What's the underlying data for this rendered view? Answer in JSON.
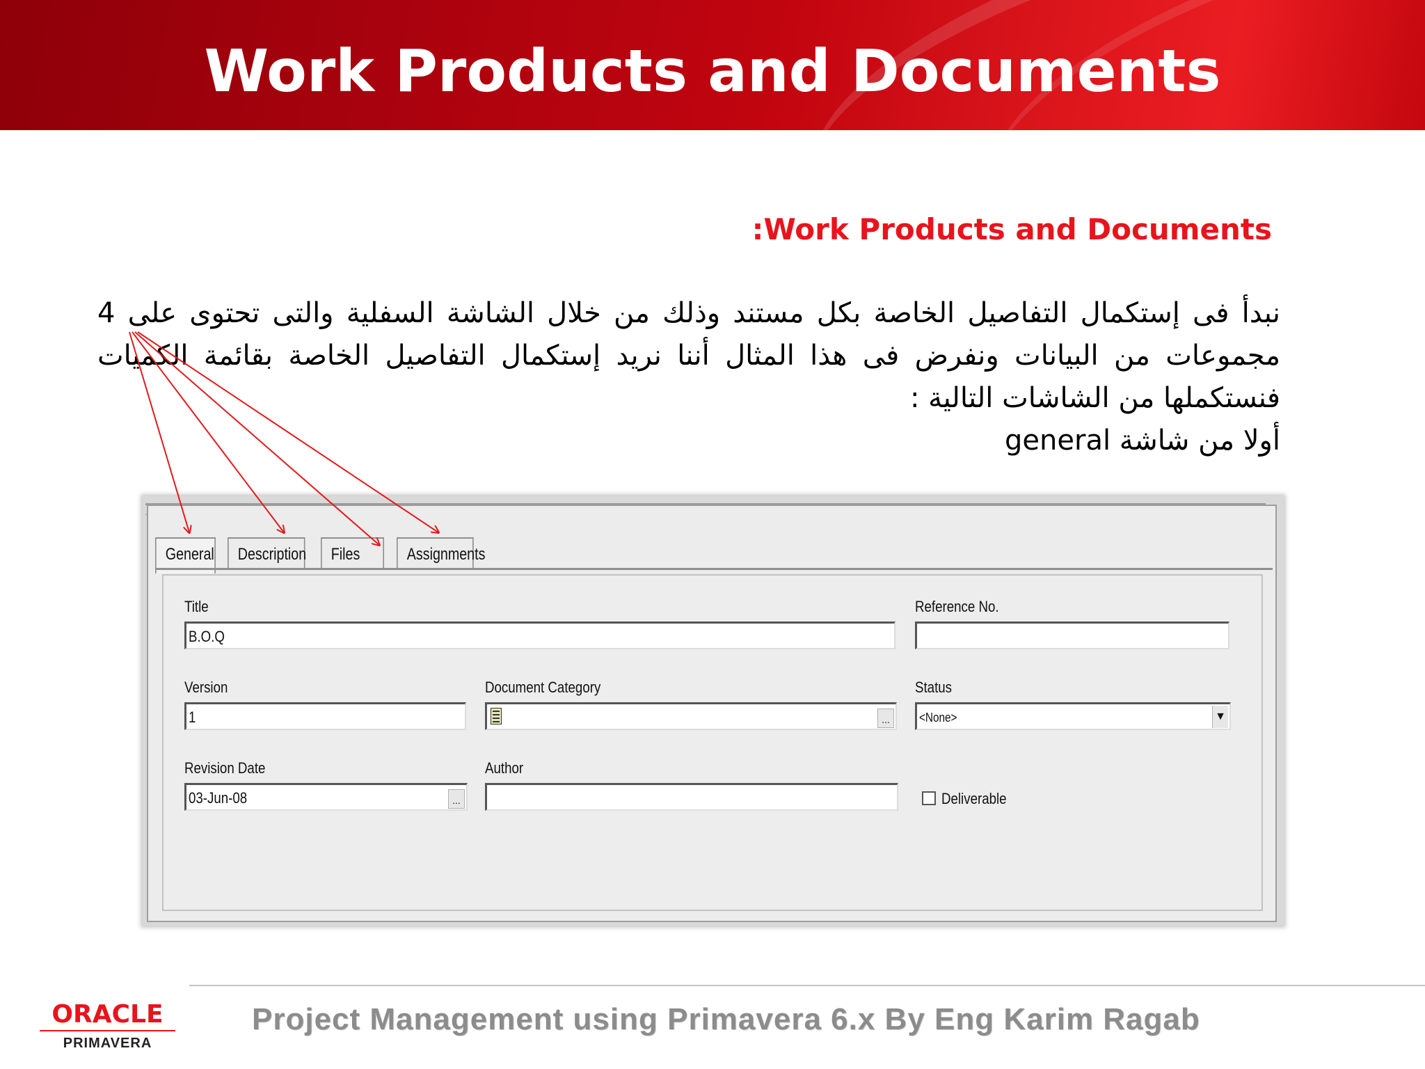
{
  "slide": {
    "title": "Work Products and Documents",
    "subtitle": ":Work Products and Documents",
    "body_lines": [
      "نبدأ فى إستكمال التفاصيل الخاصة بكل مستند وذلك من خلال الشاشة السفلية والتى تحتوى على  4",
      "مجموعات من البيانات ونفرض فى هذا المثال أننا نريد إستكمال التفاصيل الخاصة بقائمة الكميات",
      "فنستكملها من الشاشات التالية :",
      "أولا من شاشة  general"
    ]
  },
  "form": {
    "tabs": [
      {
        "label": "General"
      },
      {
        "label": "Description"
      },
      {
        "label": "Files"
      },
      {
        "label": "Assignments"
      }
    ],
    "title_label": "Title",
    "title_value": "B.O.Q",
    "reference_label": "Reference No.",
    "reference_value": "",
    "version_label": "Version",
    "version_value": "1",
    "category_label": "Document Category",
    "category_value": "",
    "status_label": "Status",
    "status_value": "<None>",
    "revision_label": "Revision Date",
    "revision_value": "03-Jun-08",
    "author_label": "Author",
    "author_value": "",
    "deliverable_label": "Deliverable",
    "deliverable_checked": false,
    "ellipsis": "...",
    "dropdown_arrow": "▼"
  },
  "footer": {
    "logo_top": "ORACLE",
    "logo_bottom": "PRIMAVERA",
    "text": "Project Management using Primavera 6.x By Eng Karim Ragab"
  },
  "colors": {
    "header_red": "#c2050f",
    "accent_red": "#e8141c",
    "arrow_red": "#e21a1a",
    "footer_gray": "#8c8c8c"
  }
}
